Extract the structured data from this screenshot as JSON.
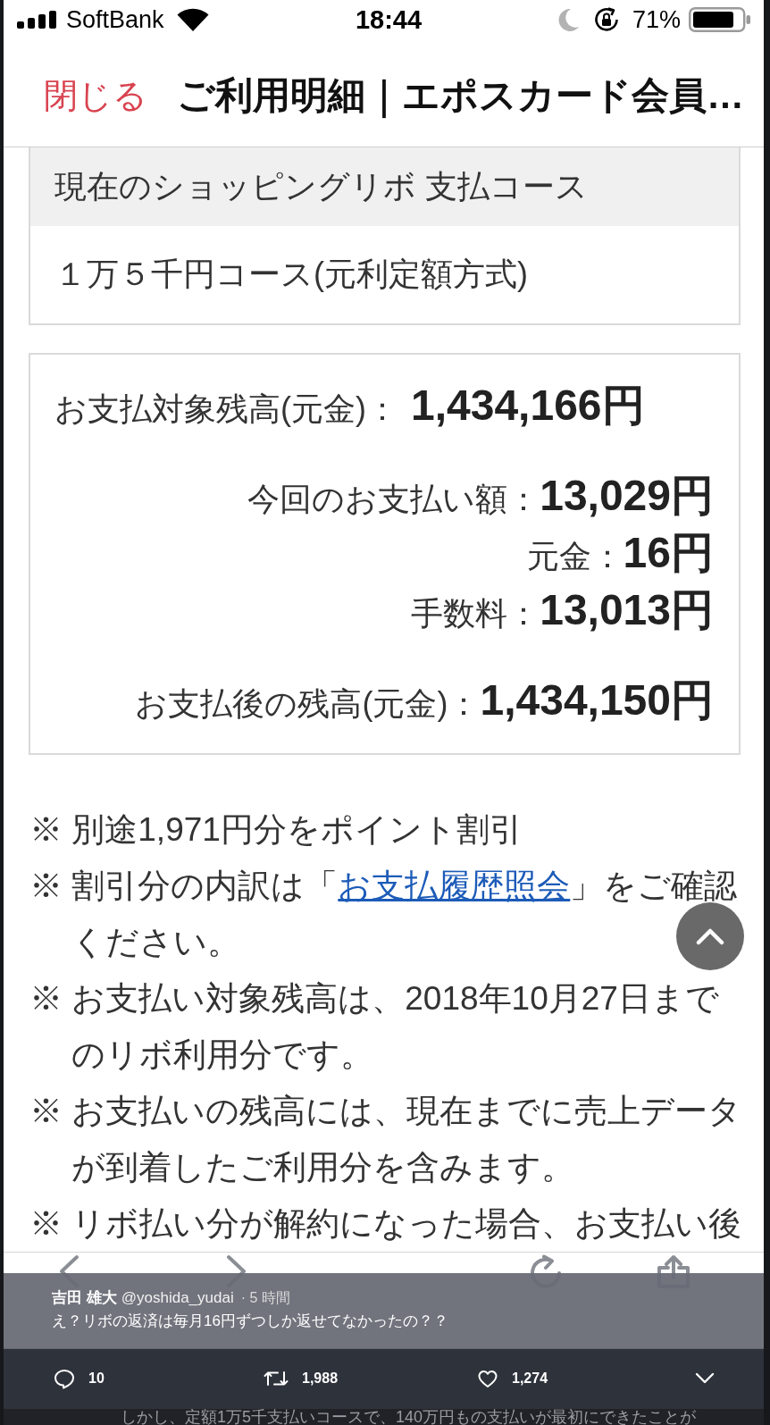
{
  "status_bar": {
    "carrier": "SoftBank",
    "time": "18:44",
    "battery": "71%"
  },
  "header": {
    "close_label": "閉じる",
    "title": "ご利用明細｜エポスカード会員…"
  },
  "course_card": {
    "heading": "現在のショッピングリボ 支払コース",
    "value": "１万５千円コース(元利定額方式)"
  },
  "balance_card": {
    "rows": [
      {
        "kind": "total",
        "label": "お支払対象残高(元金)：",
        "amount": "1,434,166円"
      },
      {
        "kind": "detail",
        "label": "今回のお支払い額：",
        "amount": "13,029円"
      },
      {
        "kind": "detail",
        "label": "元金：",
        "amount": "16円"
      },
      {
        "kind": "detail",
        "label": "手数料：",
        "amount": "13,013円"
      },
      {
        "kind": "after",
        "label": "お支払後の残高(元金)：",
        "amount": "1,434,150円"
      }
    ]
  },
  "notes": [
    {
      "segments": [
        {
          "kind": "text",
          "text": "※ 別途1,971円分をポイント割引"
        }
      ]
    },
    {
      "segments": [
        {
          "kind": "text",
          "text": "※ 割引分の内訳は「"
        },
        {
          "kind": "link",
          "text": "お支払履歴照会"
        },
        {
          "kind": "text",
          "text": "」をご確認ください。"
        }
      ]
    },
    {
      "segments": [
        {
          "kind": "text",
          "text": "※ お支払い対象残高は、2018年10月27日までのリボ利用分です。"
        }
      ]
    },
    {
      "segments": [
        {
          "kind": "text",
          "text": "※ お支払いの残高には、現在までに売上データが到着したご利用分を含みます。"
        }
      ]
    },
    {
      "segments": [
        {
          "kind": "text",
          "text": "※ リボ払い分が解約になった場合、お支払い後"
        }
      ]
    }
  ],
  "tweet": {
    "author": "吉田 雄大",
    "handle": "@yoshida_yudai",
    "time": "· 5 時間",
    "text": "え？リボの返済は毎月16円ずつしか返せてなかったの？？",
    "replies": "10",
    "retweets": "1,988",
    "likes": "1,274"
  },
  "caption": "しかし、定額1万5千支払いコースで、140万円もの支払いが最初にできたことが"
}
